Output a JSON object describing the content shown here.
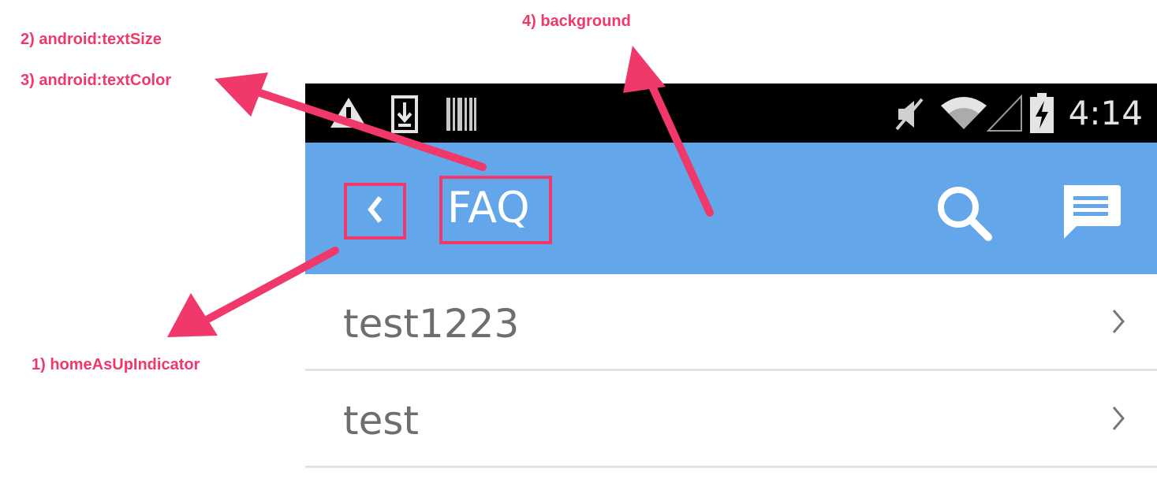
{
  "annotations": {
    "home_as_up": "1) homeAsUpIndicator",
    "text_size": "2) android:textSize",
    "text_color": "3) android:textColor",
    "background": "4) background"
  },
  "status_bar": {
    "time": "4:14",
    "left_icons": [
      "warning-icon",
      "download-icon",
      "barcode-icon"
    ],
    "right_icons": [
      "muted-icon",
      "wifi-icon",
      "signal-icon",
      "battery-charging-icon"
    ]
  },
  "action_bar": {
    "title": "FAQ",
    "background_color": "#63a6ea",
    "icons": [
      "back-icon",
      "search-icon",
      "chat-icon"
    ]
  },
  "faq_items": [
    {
      "label": "test1223"
    },
    {
      "label": "test"
    }
  ],
  "colors": {
    "annotation": "#f0386b",
    "row_text": "#6e6e6e"
  }
}
